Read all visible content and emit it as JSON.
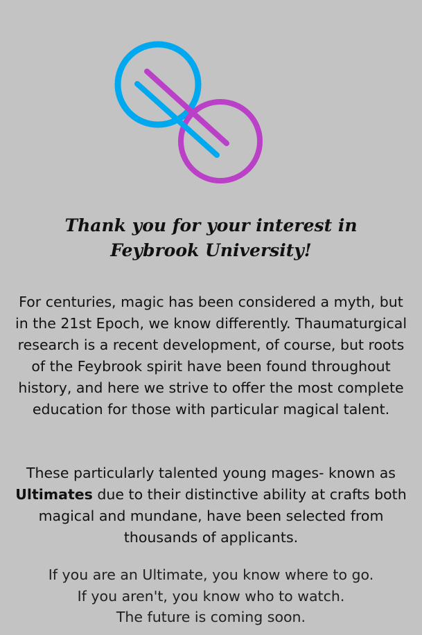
{
  "logo": {
    "icon": "feybrook-rings-logo-icon",
    "colors": {
      "blue": "#00a8f0",
      "purple": "#bb40c8"
    }
  },
  "heading": "Thank you for your interest in Feybrook University!",
  "paragraph1": "For centuries, magic has been considered a myth, but in the 21st Epoch, we know differently. Thaumaturgical research is a recent development, of course, but roots of the Feybrook spirit have been found throughout history, and here we strive to offer the most complete education for those with particular magical talent.",
  "paragraph2": {
    "intro": "These particularly talented young mages- known as",
    "term": "Ultimates",
    "rest": "due to their distinctive ability at crafts both magical and mundane, have been selected from thousands of applicants."
  },
  "closing": {
    "line1": "If you are an Ultimate, you know where to go.",
    "line2": "If you aren't, you know who to watch.",
    "line3": "The future is coming soon."
  },
  "colors": {
    "background": "#c3c3c3",
    "text": "#111111"
  }
}
